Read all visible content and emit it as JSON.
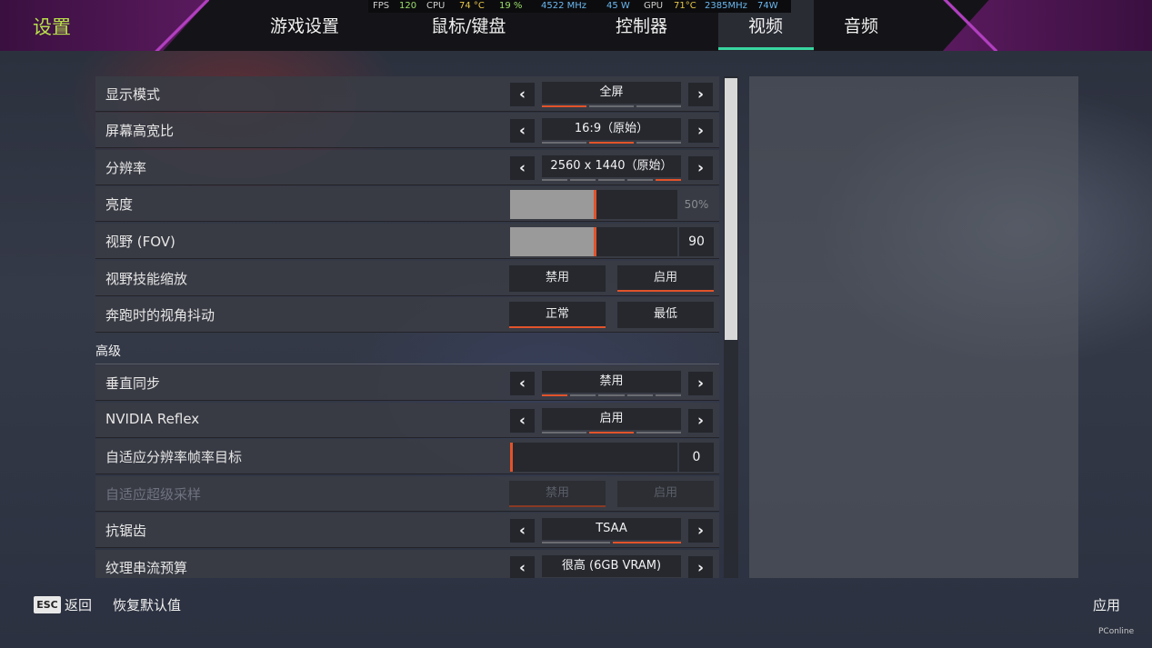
{
  "header": {
    "title": "设置",
    "tabs": [
      "游戏设置",
      "鼠标/键盘",
      "控制器",
      "视频",
      "音频"
    ],
    "active_tab": "视频"
  },
  "perf_overlay": {
    "fps_label": "FPS",
    "fps": "120",
    "cpu_label": "CPU",
    "cpu_temp": "74 °C",
    "cpu_load": "19 %",
    "cpu_clock": "4522 MHz",
    "cpu_power": "45 W",
    "gpu_label": "GPU",
    "gpu_temp": "71°C",
    "gpu_clock": "2385MHz",
    "gpu_power": "74W"
  },
  "rows": {
    "display_mode": {
      "label": "显示模式",
      "value": "全屏"
    },
    "aspect_ratio": {
      "label": "屏幕高宽比",
      "value": "16:9（原始）"
    },
    "resolution": {
      "label": "分辨率",
      "value": "2560 x 1440（原始）"
    },
    "brightness": {
      "label": "亮度",
      "value": "50%",
      "level": 0.5
    },
    "fov": {
      "label": "视野 (FOV)",
      "value": "90",
      "level": 0.5
    },
    "fov_ability_scaling": {
      "label": "视野技能缩放",
      "option_a": "禁用",
      "option_b": "启用",
      "selected": "启用"
    },
    "sprint_view_shake": {
      "label": "奔跑时的视角抖动",
      "option_a": "正常",
      "option_b": "最低",
      "selected": "正常"
    },
    "section_advanced": "高级",
    "vsync": {
      "label": "垂直同步",
      "value": "禁用"
    },
    "nvidia_reflex": {
      "label": "NVIDIA Reflex",
      "value": "启用"
    },
    "adaptive_res_target": {
      "label": "自适应分辨率帧率目标",
      "value": "0",
      "level": 0.0
    },
    "adaptive_supersampling": {
      "label": "自适应超级采样",
      "option_a": "禁用",
      "option_b": "启用",
      "disabled": true
    },
    "anti_aliasing": {
      "label": "抗锯齿",
      "value": "TSAA"
    },
    "texture_streaming": {
      "label": "纹理串流预算",
      "value": "很高 (6GB VRAM)"
    }
  },
  "footer": {
    "esc_key": "ESC",
    "back_label": "返回",
    "reset_label": "恢复默认值",
    "apply_label": "应用"
  },
  "watermark": "PConline",
  "colors": {
    "accent": "#e2532a",
    "title_green": "#b8e04a",
    "tab_underline": "#38d6a0",
    "purple": "#5a1a5e"
  }
}
